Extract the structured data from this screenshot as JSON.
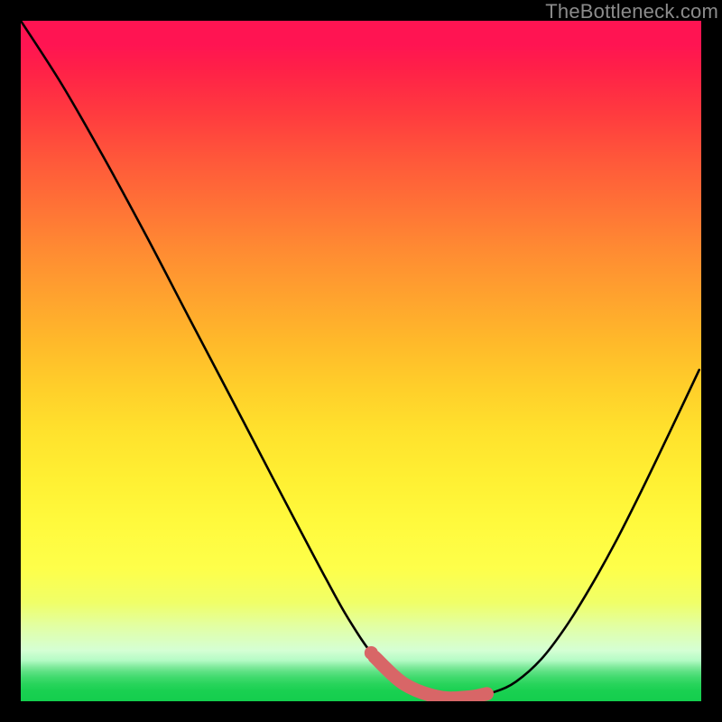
{
  "watermark": "TheBottleneck.com",
  "colors": {
    "background": "#000000",
    "curve": "#000000",
    "highlight": "#d86667",
    "watermark": "#8b8b8b"
  },
  "chart_data": {
    "type": "line",
    "title": "",
    "xlabel": "",
    "ylabel": "",
    "xlim": [
      0,
      1
    ],
    "ylim": [
      0,
      1
    ],
    "series": [
      {
        "name": "bottleneck-curve",
        "x": [
          0.0,
          0.06,
          0.122,
          0.185,
          0.246,
          0.309,
          0.371,
          0.414,
          0.448,
          0.481,
          0.52,
          0.564,
          0.615,
          0.659,
          0.697,
          0.728,
          0.765,
          0.8,
          0.835,
          0.873,
          0.912,
          0.953,
          0.997
        ],
        "y": [
          1.0,
          0.907,
          0.799,
          0.683,
          0.566,
          0.446,
          0.327,
          0.245,
          0.181,
          0.122,
          0.065,
          0.025,
          0.006,
          0.006,
          0.014,
          0.029,
          0.062,
          0.108,
          0.164,
          0.232,
          0.309,
          0.394,
          0.487
        ]
      },
      {
        "name": "bottleneck-highlight",
        "x": [
          0.515,
          0.52,
          0.564,
          0.615,
          0.659,
          0.685
        ],
        "y": [
          0.071,
          0.065,
          0.025,
          0.006,
          0.006,
          0.011
        ]
      }
    ],
    "gradient_background": {
      "type": "vertical",
      "stops": [
        {
          "pos": 0.0,
          "color": "#ff1452"
        },
        {
          "pos": 0.5,
          "color": "#ffc82a"
        },
        {
          "pos": 0.8,
          "color": "#feff4a"
        },
        {
          "pos": 1.0,
          "color": "#14ce4d"
        }
      ]
    }
  }
}
